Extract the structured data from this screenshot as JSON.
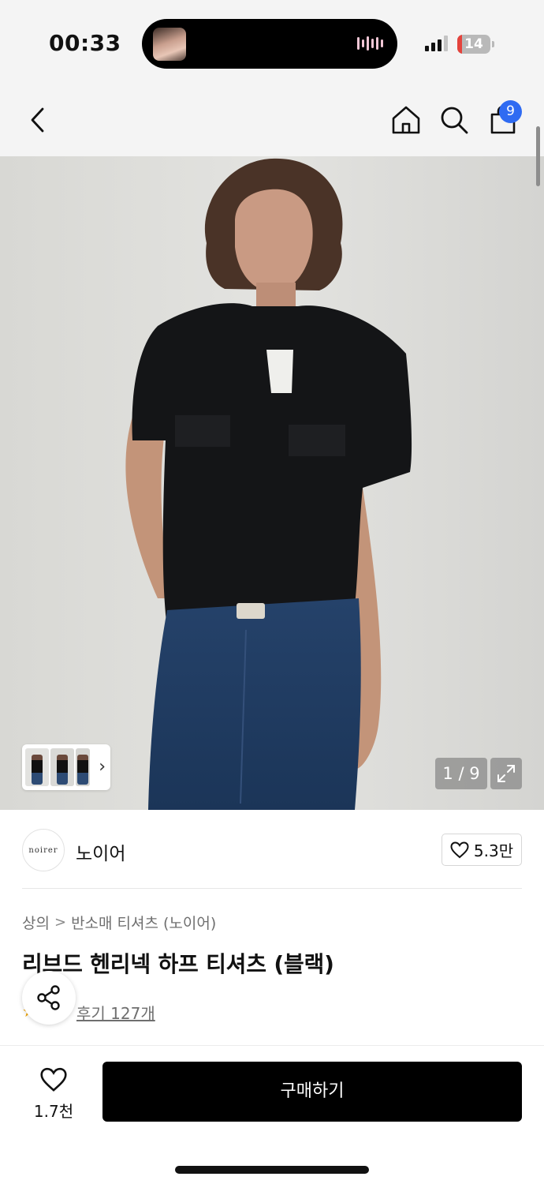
{
  "status_bar": {
    "time": "00:33",
    "battery": "14",
    "battery_level_percent": 14
  },
  "header": {
    "cart_count": "9"
  },
  "gallery": {
    "counter": "1 / 9"
  },
  "brand": {
    "logo_text": "noirer",
    "name": "노이어",
    "likes": "5.3만"
  },
  "product": {
    "breadcrumb": [
      "상의",
      "반소매 티셔츠 (노이어)"
    ],
    "title": "리브드 헨리넥 하프 티셔츠 (블랙)",
    "reviews": "후기 127개"
  },
  "bottom_bar": {
    "wish_count": "1.7천",
    "buy_label": "구매하기"
  },
  "colors": {
    "accent_badge": "#2f6bf2",
    "buy_button": "#000000",
    "battery_low": "#e4433c",
    "rating_star": "#f2a500"
  }
}
